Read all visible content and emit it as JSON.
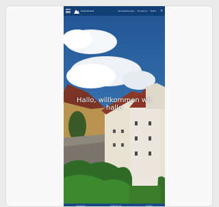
{
  "header": {
    "logo_text": "Landratsamt",
    "nav": [
      "Veranstaltungen",
      "Tourismus",
      "Kultur"
    ]
  },
  "hero": {
    "headline": "Hallo, willkommen wir hallo"
  },
  "footer": {
    "links": [
      "Impressum",
      "Datenschutz",
      "Kontakt"
    ]
  },
  "colors": {
    "header_bg": "#0b2c5c",
    "sky": "#2f6aa8",
    "footer_bg": "#184a85"
  },
  "icons": [
    "menu-icon",
    "logo-icon",
    "search-icon"
  ]
}
